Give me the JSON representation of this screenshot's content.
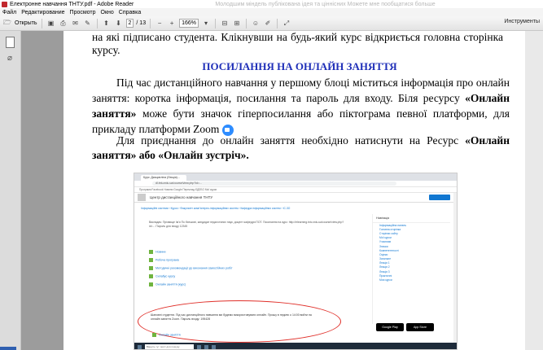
{
  "window": {
    "title": "Електронне навчання ТНТУ.pdf - Adobe Reader",
    "ghost_text": "Молодшим міндель публікована ідея та ціннісних Можете мне пообщатися больше"
  },
  "menu": [
    "Файл",
    "Редактирование",
    "Просмотр",
    "Окно",
    "Справка"
  ],
  "toolbar": {
    "open_label": "Открыть",
    "page_current": "2",
    "page_total": "/ 13",
    "zoom": "166%",
    "tools_label": "Инструменты"
  },
  "document": {
    "p1": "на які підписано студента. Клікнувши на будь-який курс відкриється головна сторінка курсу.",
    "heading": "ПОСИЛАННЯ НА ОНЛАЙН ЗАНЯТТЯ",
    "p2_start": "Під час дистанційного навчання у першому блоці міститься інформація про онлайн заняття: коротка інформація, посилання та пароль для входу. Біля ресурсу ",
    "p2_bold": "«Онлайн заняття»",
    "p2_end": " може бути значок гіперпосилання або піктограма певної платформи, для прикладу платформи Zoom",
    "p3_start": "Для приєднання до онлайн заняття необхідно натиснути на Ресурс ",
    "p3_bold": "«Онлайн заняття» або «Онлайн зустріч».",
    "zoom_icon": "zoom-camera-icon"
  },
  "embedded_screenshot": {
    "tab": "Курс: Дисципліна (Лекція)...",
    "url": "dl.tntu.edu.ua/course/view.php?id=...",
    "bookmarks": "Програми   Facebook   Новини   Google Переклад   ЄДЕБО   Мої курси",
    "site_title": "Центр дистанційного навчання ТНТУ",
    "breadcrumb": "Інформаційні системи › Курси › Факультет комп'ютерно-інформаційних систем › Кафедра інформаційних систем › ІС-3О",
    "teacher_text": "Викладач: Прізвище Ім'я По батькові, кандидат педагогічних наук, доцент кафедри ПОТ. Посилання на курс: http://elearning.tntu.edu.ua/course/view.php?id=... Пароль для входу 12345",
    "links": [
      "Новини",
      "Робоча програма",
      "Методичні рекомендації до виконання самостійних робіт",
      "Силабус курсу",
      "Онлайн заняття (курс)"
    ],
    "notice": "Шановні студенти. Під час дистанційного навчання ми будемо використовувати онлайн. Прошу в неділю о 14:00 вийти на онлайн заняття Zoom. Пароль входу: 195428",
    "last_link": "Онлайн заняття",
    "sidebar_head": "Навігація",
    "sidebar_items": [
      "Інформаційна панель",
      "Головна сторінка",
      "Сторінки сайту",
      "Мої курси",
      "Учасники",
      "Значки",
      "Компетентності",
      "Оцінки",
      "Загальне",
      "Лекція 1",
      "Лекція 2",
      "Лекція 3",
      "Практичні",
      "Моя курси"
    ],
    "store_labels": [
      "Google Play",
      "App Store"
    ],
    "taskbar_search": "Введіть тут текст для пошуку"
  }
}
